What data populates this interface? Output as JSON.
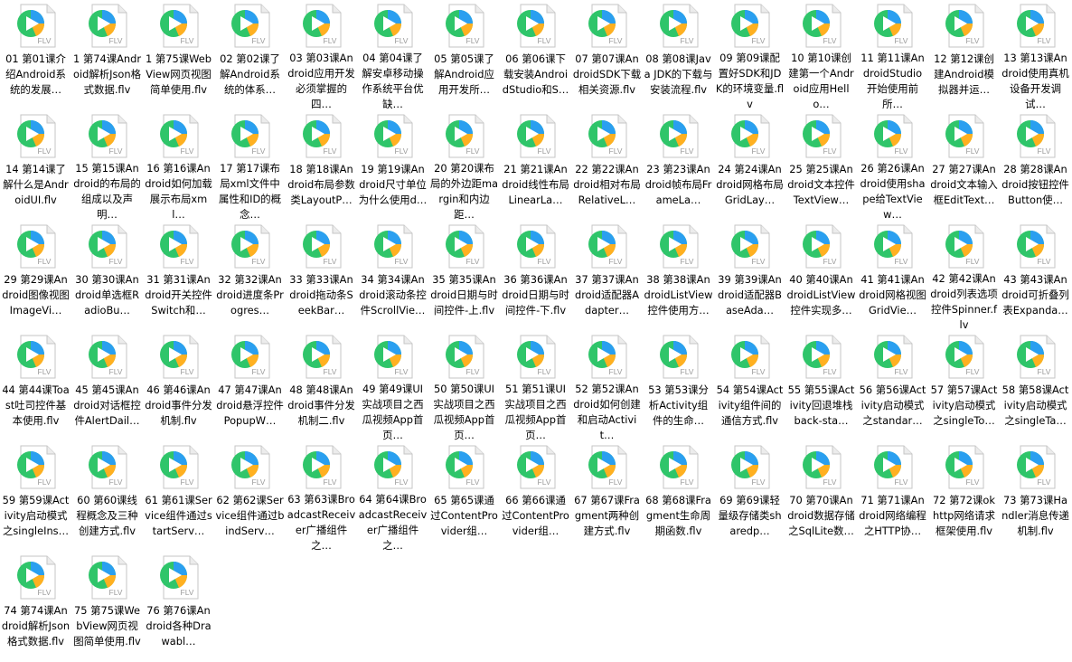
{
  "icon": {
    "name": "flv-video-file-icon",
    "ext_label": "FLV"
  },
  "colors": {
    "play_green": "#2fc56a",
    "play_blue": "#2a9ff0",
    "play_orange": "#ffb020",
    "page_bg": "#ffffff"
  },
  "files": [
    {
      "label": "01 第01课介绍Android系统的发展…"
    },
    {
      "label": "1 第74课Android解析Json格式数据.flv"
    },
    {
      "label": "1 第75课WebView网页视图简单使用.flv"
    },
    {
      "label": "02 第02课了解Android系统的体系…"
    },
    {
      "label": "03 第03课Android应用开发必须掌握的四…"
    },
    {
      "label": "04 第04课了解安卓移动操作系统平台优缺…"
    },
    {
      "label": "05 第05课了解Android应用开发所…"
    },
    {
      "label": "06 第06课下载安装AndroidStudio和S…"
    },
    {
      "label": "07 第07课AndroidSDK下载相关资源.flv"
    },
    {
      "label": "08 第08课Java JDK的下载与安装流程.flv"
    },
    {
      "label": "09 第09课配置好SDK和JDK的环境变量.flv"
    },
    {
      "label": "10 第10课创建第一个Android应用Hello…"
    },
    {
      "label": "11 第11课AndroidStudio开始使用前所…"
    },
    {
      "label": "12 第12课创建Android模拟器并运…"
    },
    {
      "label": "13 第13课Android使用真机设备开发调试…"
    },
    {
      "label": "14 第14课了解什么是AndroidUI.flv"
    },
    {
      "label": "15 第15课Android的布局的组成以及声明…"
    },
    {
      "label": "16 第16课Android如何加载展示布局xml…"
    },
    {
      "label": "17 第17课布局xml文件中属性和ID的概念…"
    },
    {
      "label": "18 第18课Android布局参数类LayoutP…"
    },
    {
      "label": "19 第19课Android尺寸单位为什么使用d…"
    },
    {
      "label": "20 第20课布局的外边距margin和内边距…"
    },
    {
      "label": "21 第21课Android线性布局LinearLa…"
    },
    {
      "label": "22 第22课Android相对布局RelativeL…"
    },
    {
      "label": "23 第23课Android帧布局FrameLa…"
    },
    {
      "label": "24 第24课Android网格布局GridLay…"
    },
    {
      "label": "25 第25课Android文本控件TextView…"
    },
    {
      "label": "26 第26课Android使用shape给TextView…"
    },
    {
      "label": "27 第27课Android文本输入框EditText…"
    },
    {
      "label": "28 第28课Android按钮控件Button使…"
    },
    {
      "label": "29 第29课Android图像视图ImageVi…"
    },
    {
      "label": "30 第30课Android单选框RadioBu…"
    },
    {
      "label": "31 第31课Android开关控件Switch和…"
    },
    {
      "label": "32 第32课Android进度条Progres…"
    },
    {
      "label": "33 第33课Android拖动条SeekBar…"
    },
    {
      "label": "34 第34课Android滚动条控件ScrollVie…"
    },
    {
      "label": "35 第35课Android日期与时间控件-上.flv"
    },
    {
      "label": "36 第36课Android日期与时间控件-下.flv"
    },
    {
      "label": "37 第37课Android适配器Adapter…"
    },
    {
      "label": "38 第38课AndroidListView控件使用方…"
    },
    {
      "label": "39 第39课Android适配器BaseAda…"
    },
    {
      "label": "40 第40课AndroidListView控件实现多…"
    },
    {
      "label": "41 第41课Android网格视图GridVie…"
    },
    {
      "label": "42 第42课Android列表选项控件Spinner.flv"
    },
    {
      "label": "43 第43课Android可折叠列表Expanda…"
    },
    {
      "label": "44 第44课Toast吐司控件基本使用.flv"
    },
    {
      "label": "45 第45课Android对话框控件AlertDail…"
    },
    {
      "label": "46 第46课Android事件分发机制.flv"
    },
    {
      "label": "47 第47课Android悬浮控件PopupW…"
    },
    {
      "label": "48 第48课Android事件分发机制二.flv"
    },
    {
      "label": "49 第49课UI实战项目之西瓜视频App首页…"
    },
    {
      "label": "50 第50课UI实战项目之西瓜视频App首页…"
    },
    {
      "label": "51 第51课UI实战项目之西瓜视频App首页…"
    },
    {
      "label": "52 第52课Android如何创建和启动Activit…"
    },
    {
      "label": "53 第53课分析Activity组件的生命…"
    },
    {
      "label": "54 第54课Activity组件间的通信方式.flv"
    },
    {
      "label": "55 第55课Activity回退堆栈back-sta…"
    },
    {
      "label": "56 第56课Activity启动模式之standar…"
    },
    {
      "label": "57 第57课Activity启动模式之singleTo…"
    },
    {
      "label": "58 第58课Activity启动模式之singleTa…"
    },
    {
      "label": "59 第59课Activity启动模式之singleIns…"
    },
    {
      "label": "60 第60课线程概念及三种创建方式.flv"
    },
    {
      "label": "61 第61课Service组件通过startServ…"
    },
    {
      "label": "62 第62课Service组件通过bindServ…"
    },
    {
      "label": "63 第63课BroadcastReceiver广播组件之…"
    },
    {
      "label": "64 第64课BroadcastReceiver广播组件之…"
    },
    {
      "label": "65 第65课通过ContentProvider组…"
    },
    {
      "label": "66 第66课通过ContentProvider组…"
    },
    {
      "label": "67 第67课Fragment两种创建方式.flv"
    },
    {
      "label": "68 第68课Fragment生命周期函数.flv"
    },
    {
      "label": "69 第69课轻量级存储类sharedp…"
    },
    {
      "label": "70 第70课Android数据存储之SqlLite数…"
    },
    {
      "label": "71 第71课Android网络编程之HTTP协…"
    },
    {
      "label": "72 第72课okhttp网络请求框架使用.flv"
    },
    {
      "label": "73 第73课Handler消息传递机制.flv"
    },
    {
      "label": "74 第74课Android解析Json格式数据.flv"
    },
    {
      "label": "75 第75课WebView网页视图简单使用.flv"
    },
    {
      "label": "76 第76课Android各种Drawabl…"
    }
  ]
}
